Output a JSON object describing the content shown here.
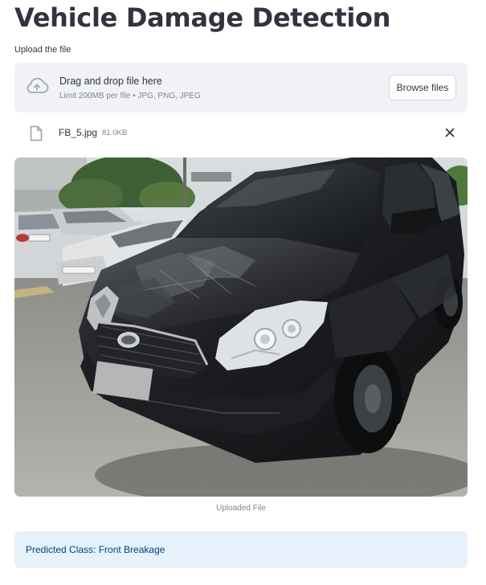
{
  "page": {
    "title": "Vehicle Damage Detection"
  },
  "uploader": {
    "label": "Upload the file",
    "dropzone_text": "Drag and drop file here",
    "limits_text": "Limit 200MB per file • JPG, PNG, JPEG",
    "browse_label": "Browse files",
    "upload_icon": "cloud-upload-icon"
  },
  "uploaded_file": {
    "name": "FB_5.jpg",
    "size": "81.0KB",
    "file_icon": "file-icon",
    "remove_icon": "close-icon"
  },
  "image": {
    "caption": "Uploaded File"
  },
  "result": {
    "text": "Predicted Class: Front Breakage"
  },
  "colors": {
    "background": "#ffffff",
    "text": "#31333f",
    "muted_text": "#808495",
    "dropzone_bg": "#f0f2f6",
    "info_bg": "#e6f1fb",
    "info_text": "#004280"
  }
}
